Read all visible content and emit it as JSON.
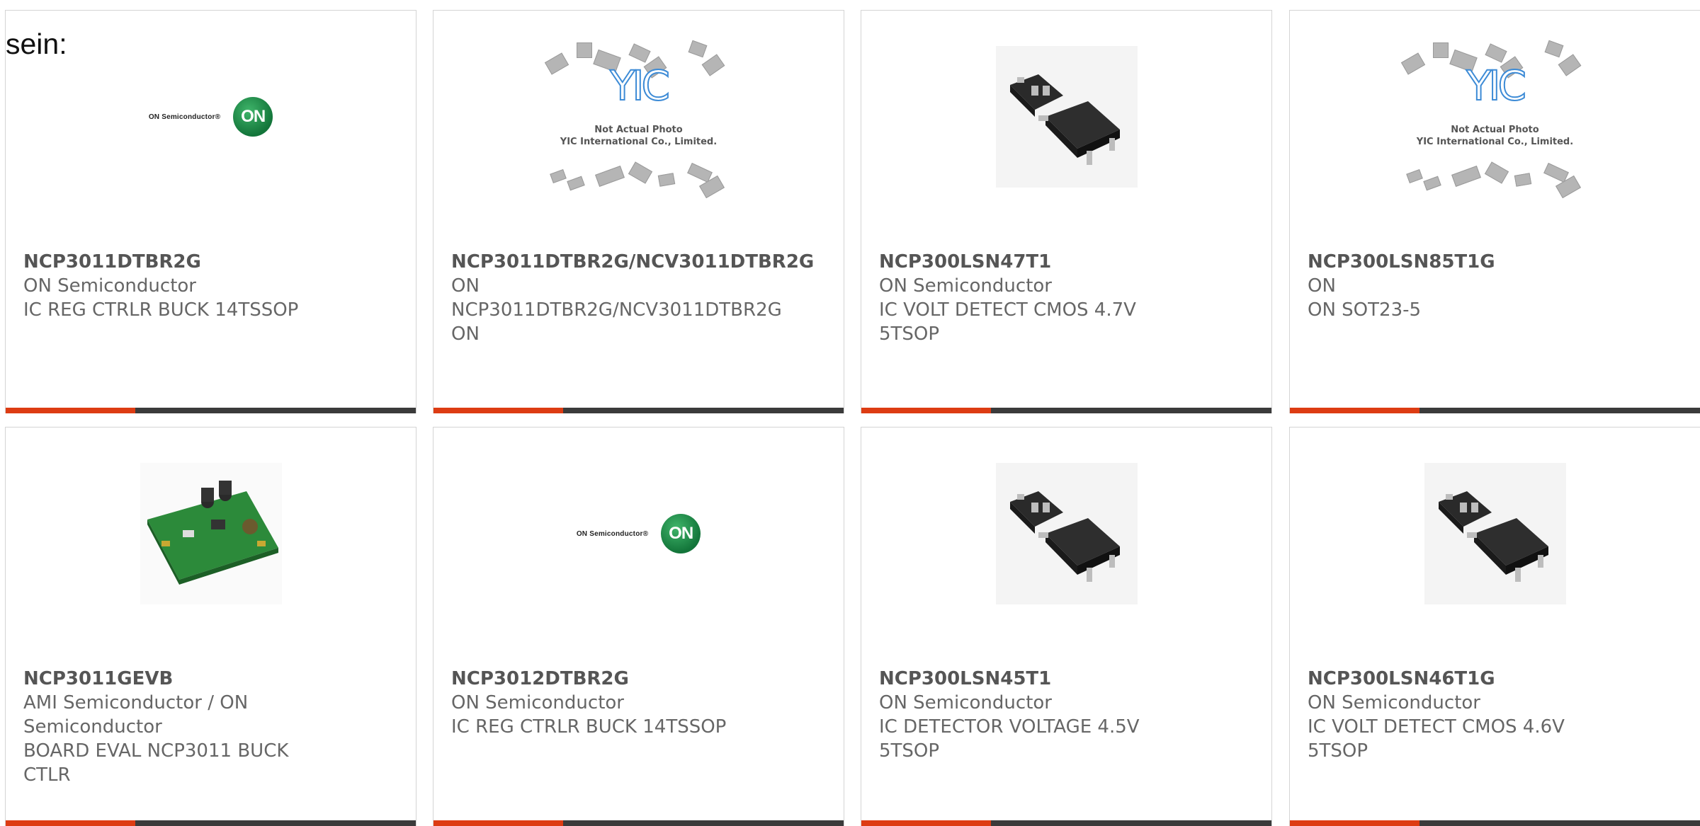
{
  "intro_text": "sein:",
  "icons": {
    "on_logo": "on-semiconductor-logo",
    "yic": "yic-placeholder-image",
    "sot": "sot23-package-image",
    "pcb": "eval-board-image"
  },
  "colors": {
    "accent": "#dd3c13",
    "bar": "#3b3b3b",
    "text": "#666666"
  },
  "on_logo": {
    "wordmark": "ON Semiconductor®",
    "mark": "ON"
  },
  "yic_placeholder": {
    "logo": "YIC",
    "caption_line1": "Not Actual Photo",
    "caption_line2": "YIC International Co., Limited."
  },
  "products": [
    {
      "part": "NCP3011DTBR2G",
      "lines": [
        "ON Semiconductor",
        "IC REG CTRLR BUCK 14TSSOP"
      ],
      "image": "on-logo"
    },
    {
      "part": "NCP3011DTBR2G/NCV3011DTBR2G",
      "lines": [
        "ON",
        "NCP3011DTBR2G/NCV3011DTBR2G",
        "ON"
      ],
      "image": "yic"
    },
    {
      "part": "NCP300LSN47T1",
      "lines": [
        "ON Semiconductor",
        "IC VOLT DETECT CMOS 4.7V",
        "5TSOP"
      ],
      "image": "sot"
    },
    {
      "part": "NCP300LSN85T1G",
      "lines": [
        "ON",
        "ON SOT23-5"
      ],
      "image": "yic"
    },
    {
      "part": "NCP3011GEVB",
      "lines": [
        "AMI Semiconductor / ON",
        "Semiconductor",
        "BOARD EVAL NCP3011 BUCK",
        "CTLR"
      ],
      "image": "pcb"
    },
    {
      "part": "NCP3012DTBR2G",
      "lines": [
        "ON Semiconductor",
        "IC REG CTRLR BUCK 14TSSOP"
      ],
      "image": "on-logo"
    },
    {
      "part": "NCP300LSN45T1",
      "lines": [
        "ON Semiconductor",
        "IC DETECTOR VOLTAGE 4.5V",
        "5TSOP"
      ],
      "image": "sot"
    },
    {
      "part": "NCP300LSN46T1G",
      "lines": [
        "ON Semiconductor",
        "IC VOLT DETECT CMOS 4.6V",
        "5TSOP"
      ],
      "image": "sot"
    }
  ]
}
